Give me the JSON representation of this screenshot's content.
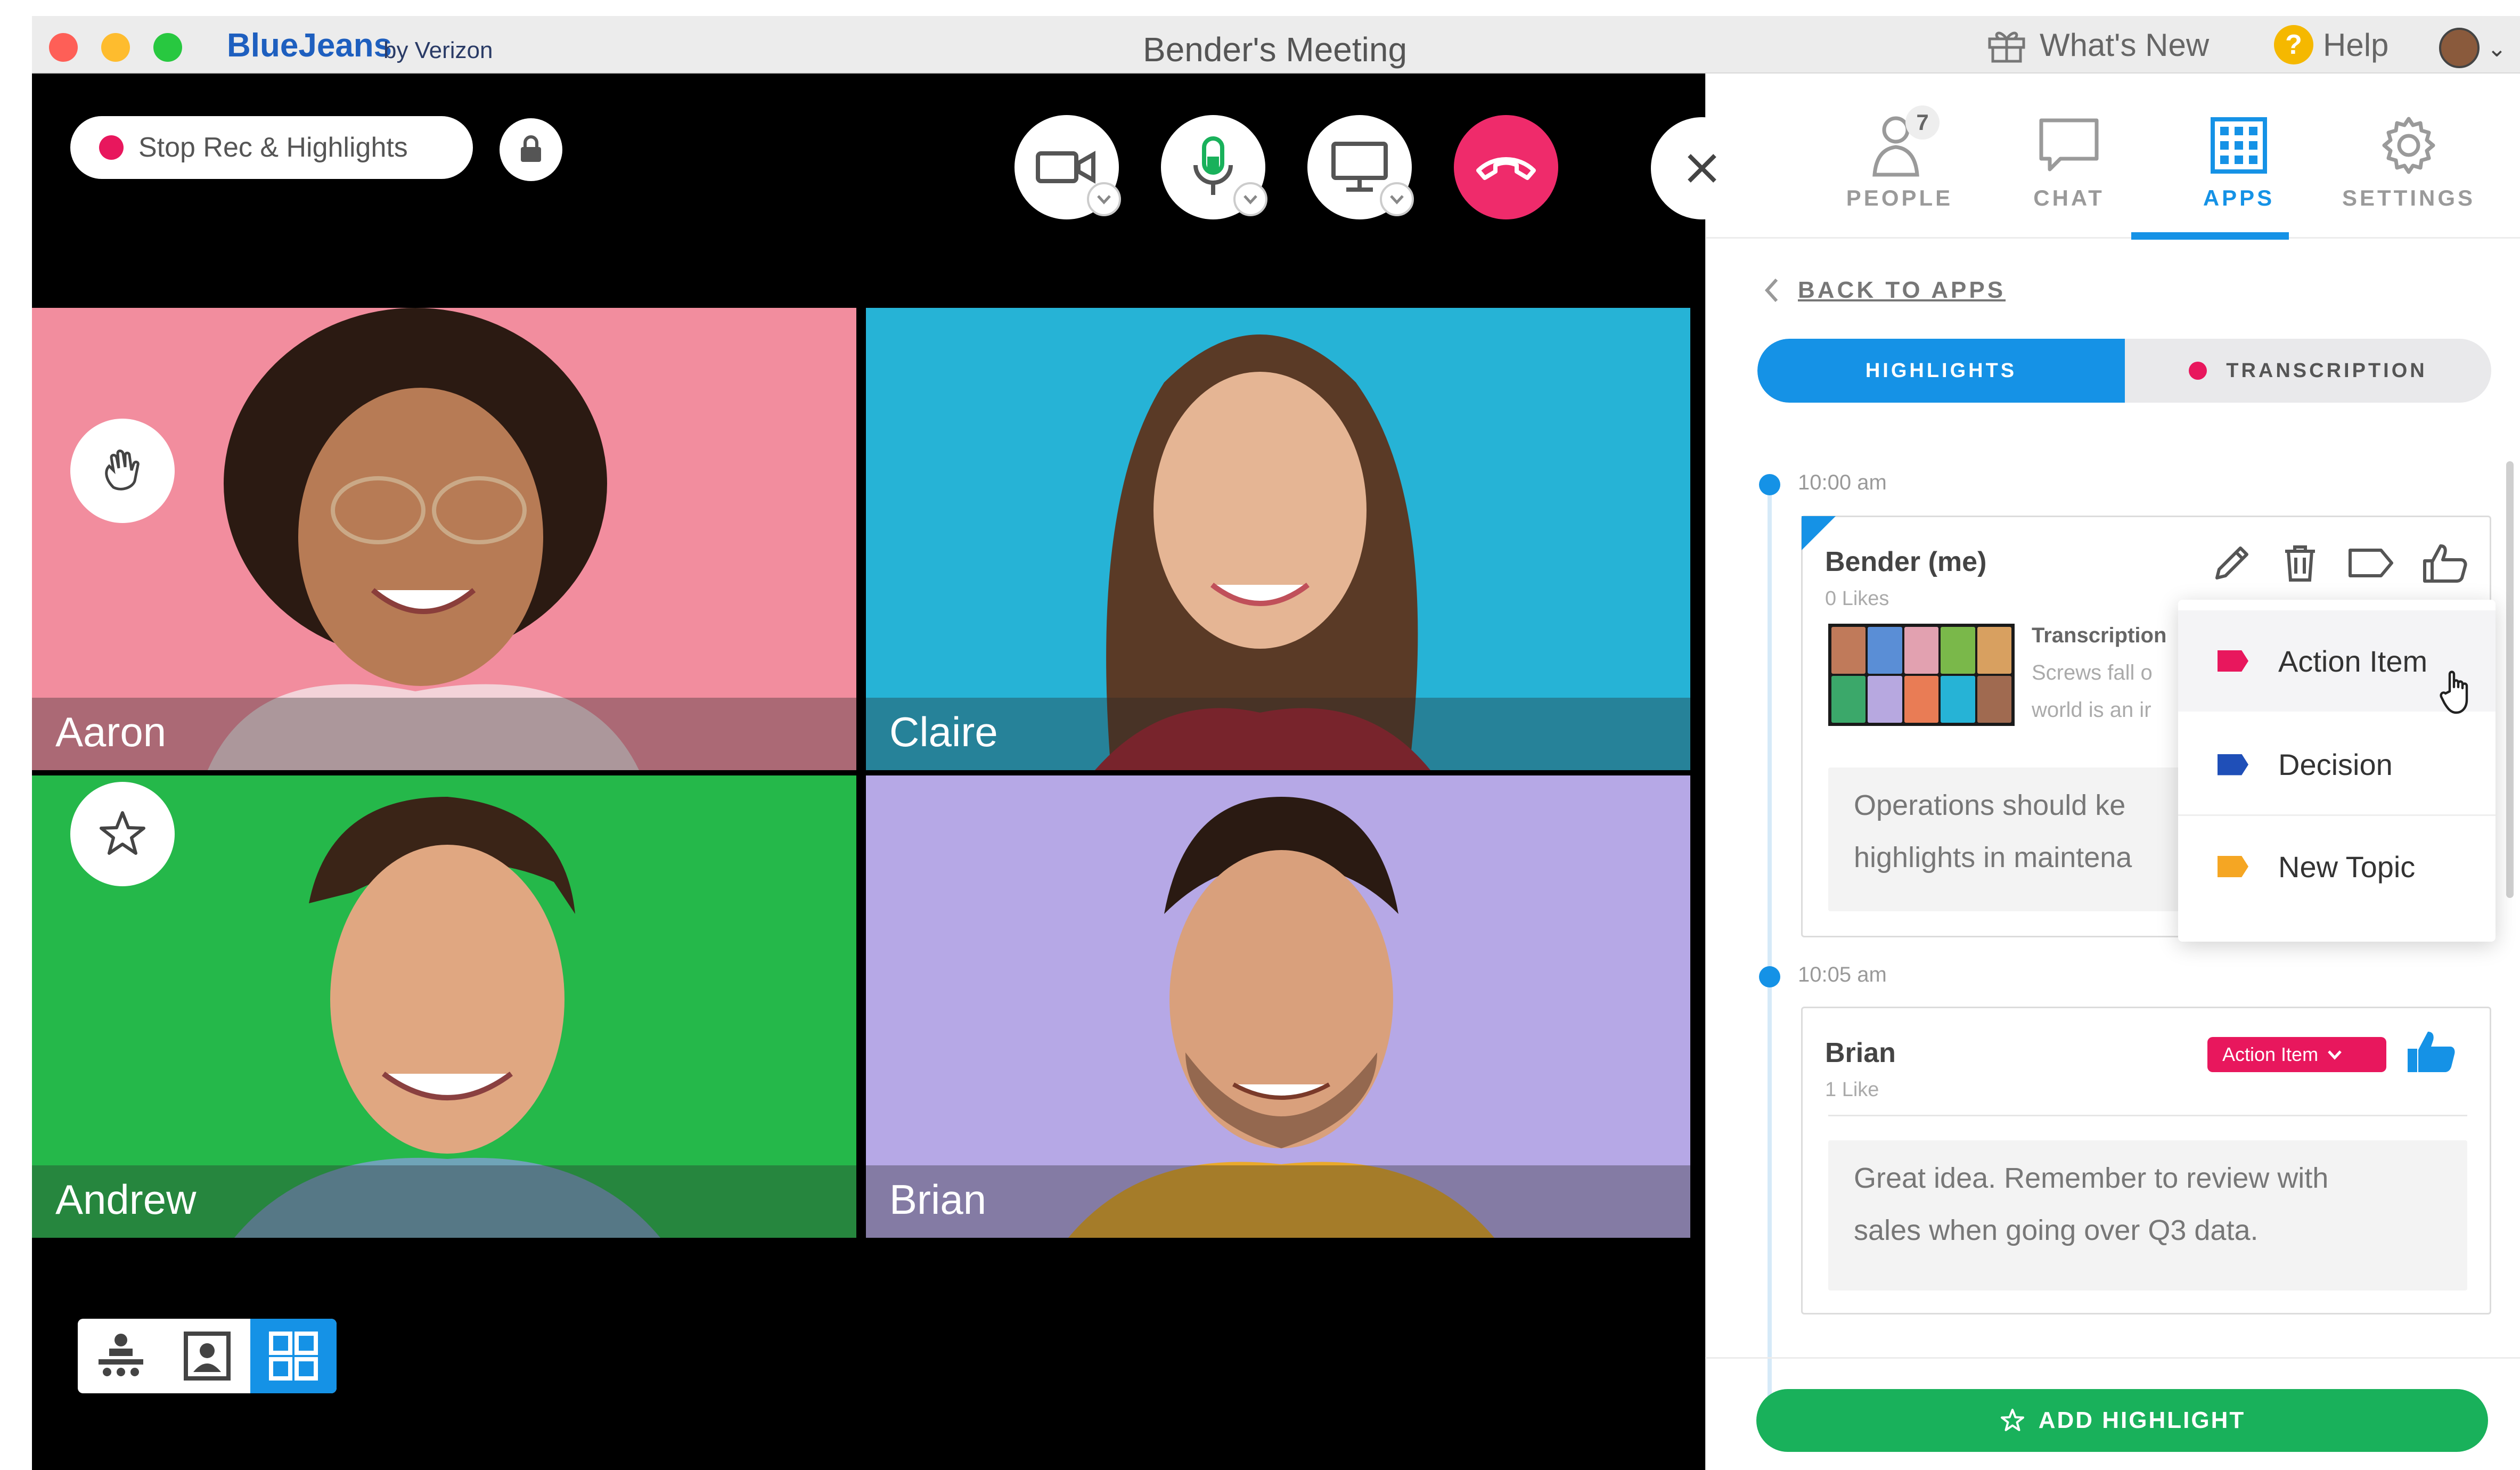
{
  "window": {
    "brand": "BlueJeans",
    "brand_sub": "by Verizon",
    "title": "Bender's Meeting",
    "whats_new": "What's New",
    "help": "Help"
  },
  "toolbar": {
    "record_label": "Stop Rec & Highlights"
  },
  "participants": [
    {
      "name": "Aaron"
    },
    {
      "name": "Claire"
    },
    {
      "name": "Andrew"
    },
    {
      "name": "Brian"
    }
  ],
  "panel": {
    "tabs": [
      {
        "label": "PEOPLE",
        "badge": "7"
      },
      {
        "label": "CHAT"
      },
      {
        "label": "APPS"
      },
      {
        "label": "SETTINGS"
      }
    ],
    "back_label": "BACK TO APPS",
    "segments": {
      "highlights": "HIGHLIGHTS",
      "transcription": "TRANSCRIPTION"
    },
    "highlights": [
      {
        "time": "10:00 am",
        "author": "Bender (me)",
        "likes": "0 Likes",
        "transcript_title": "Transcription",
        "transcript_line1": "Screws fall o",
        "transcript_line2": "world is an ir",
        "text": "Operations should ke\nhighlights in maintena"
      },
      {
        "time": "10:05 am",
        "author": "Brian",
        "likes": "1 Like",
        "tag": "Action Item",
        "text": "Great idea. Remember to review with\nsales when going over Q3 data."
      }
    ],
    "tag_menu": [
      {
        "label": "Action Item",
        "color": "#e8175d"
      },
      {
        "label": "Decision",
        "color": "#1f4fb8"
      },
      {
        "label": "New Topic",
        "color": "#f5a623"
      }
    ],
    "add_button": "ADD HIGHLIGHT"
  },
  "colors": {
    "accent": "#1592e6",
    "hangup": "#ef2b6b",
    "record": "#e8175d",
    "add": "#19b15b"
  }
}
